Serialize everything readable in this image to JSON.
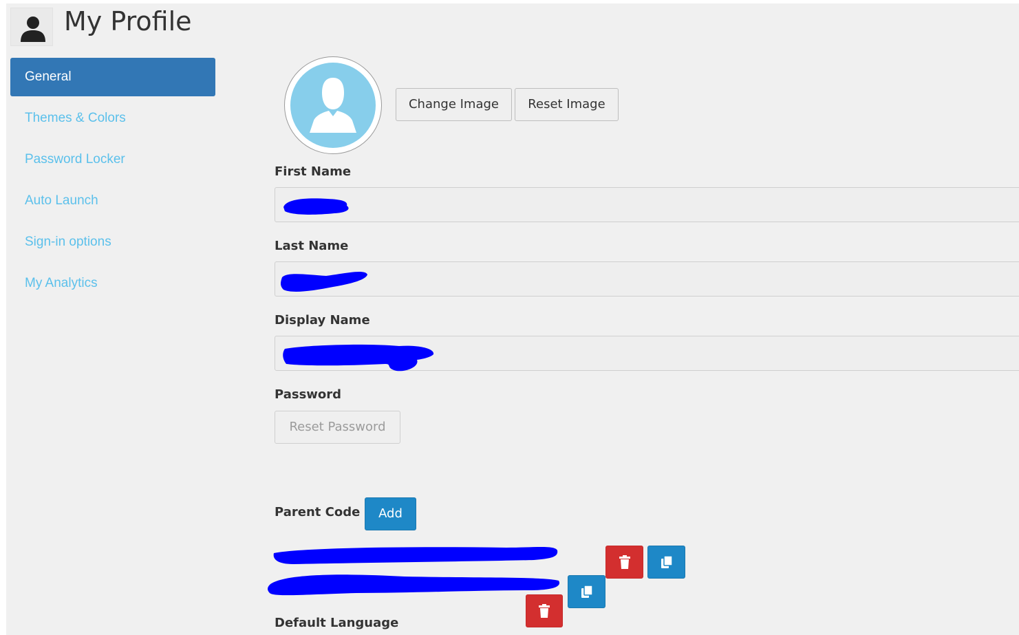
{
  "header": {
    "title": "My Profile",
    "icon": "user-icon"
  },
  "sidebar": {
    "items": [
      {
        "label": "General",
        "active": true
      },
      {
        "label": "Themes & Colors",
        "active": false
      },
      {
        "label": "Password Locker",
        "active": false
      },
      {
        "label": "Auto Launch",
        "active": false
      },
      {
        "label": "Sign-in options",
        "active": false
      },
      {
        "label": "My Analytics",
        "active": false
      }
    ]
  },
  "avatar": {
    "icon": "avatar-placeholder-icon",
    "change_label": "Change Image",
    "reset_label": "Reset Image"
  },
  "fields": {
    "first_name_label": "First Name",
    "last_name_label": "Last Name",
    "display_name_label": "Display Name",
    "password_label": "Password",
    "reset_password_label": "Reset Password"
  },
  "parent_code": {
    "label": "Parent Code",
    "add_label": "Add",
    "entries": [
      {
        "delete_icon": "trash-icon",
        "copy_icon": "copy-icon"
      },
      {
        "delete_icon": "trash-icon",
        "copy_icon": "copy-icon"
      }
    ]
  },
  "default_language": {
    "label": "Default Language"
  },
  "colors": {
    "active_nav": "#3277b5",
    "link": "#5bc0eb",
    "primary": "#1e88c7",
    "danger": "#d32f2f",
    "avatar_bg": "#87ceeb",
    "redaction": "#0000ff"
  }
}
